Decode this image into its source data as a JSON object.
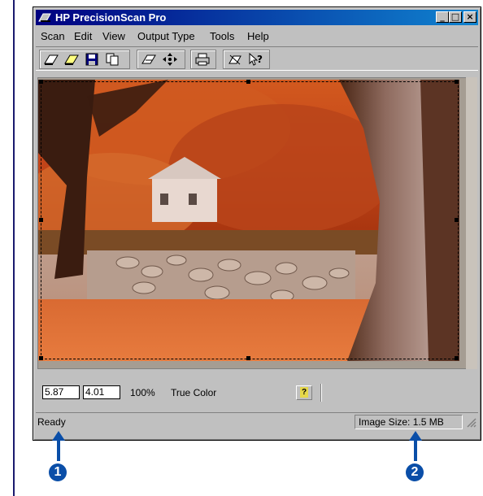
{
  "window": {
    "title": "HP PrecisionScan Pro"
  },
  "menu": [
    {
      "label": "Scan"
    },
    {
      "label": "Edit"
    },
    {
      "label": "View"
    },
    {
      "label": "Output Type"
    },
    {
      "label": "Tools"
    },
    {
      "label": "Help"
    }
  ],
  "toolbar": {
    "icons": [
      "scan-icon",
      "new-scan-icon",
      "save-icon",
      "copy-icon",
      "zoom-icon",
      "move-icon",
      "print-icon",
      "crop-icon",
      "help-pointer-icon"
    ]
  },
  "status_row": {
    "width_value": "5.87",
    "height_value": "4.01",
    "scale": "100%",
    "color_mode": "True Color"
  },
  "statusbar": {
    "ready": "Ready",
    "image_size": "Image Size: 1.5 MB"
  },
  "callouts": {
    "first": "1",
    "second": "2"
  },
  "colors": {
    "title_gradient_start": "#000080",
    "title_gradient_end": "#1084d0",
    "callout": "#0a4ea8"
  }
}
